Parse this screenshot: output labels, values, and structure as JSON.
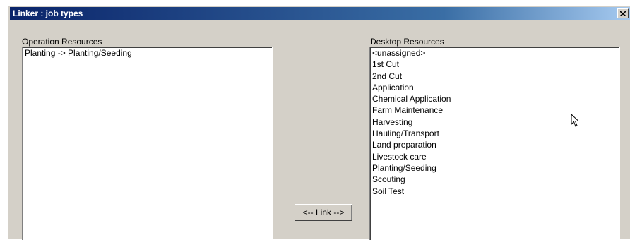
{
  "window": {
    "title": "Linker : job types"
  },
  "operation_resources": {
    "label": "Operation Resources",
    "items": [
      "Planting -> Planting/Seeding"
    ]
  },
  "desktop_resources": {
    "label": "Desktop Resources",
    "items": [
      "<unassigned>",
      "1st Cut",
      "2nd Cut",
      "Application",
      "Chemical Application",
      "Farm Maintenance",
      "Harvesting",
      "Hauling/Transport",
      "Land preparation",
      "Livestock care",
      "Planting/Seeding",
      "Scouting",
      "Soil Test"
    ]
  },
  "link_button": {
    "label": "<-- Link -->"
  },
  "icons": {
    "close": "close-icon",
    "cursor": "mouse-cursor-icon"
  },
  "colors": {
    "titlebar": "#0a246a",
    "dialog_bg": "#d4d0c8"
  }
}
